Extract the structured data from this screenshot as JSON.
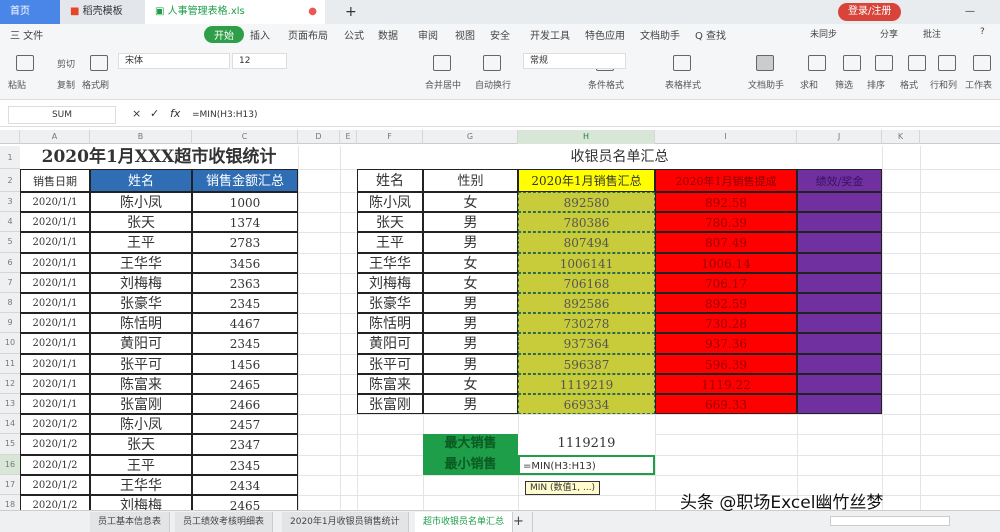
{
  "window": {
    "tabs": [
      {
        "label": "首页"
      },
      {
        "label": "稻壳模板"
      },
      {
        "label": "人事管理表格.xls"
      }
    ],
    "new_tab": "+",
    "user_button": "登录/注册"
  },
  "menu": {
    "file": "三 文件",
    "items": [
      "开始",
      "插入",
      "页面布局",
      "公式",
      "数据",
      "审阅",
      "视图",
      "安全",
      "开发工具",
      "特色应用",
      "文档助手",
      "Q 查找"
    ],
    "right": [
      "未同步",
      "分享",
      "批注",
      "?"
    ]
  },
  "ribbon": {
    "paste": "粘贴",
    "cut": "剪切",
    "copy": "复制",
    "format_painter": "格式刷",
    "font": "宋体",
    "size": "12",
    "merge": "合并居中",
    "wrap": "自动换行",
    "number_format": "常规",
    "cond_format": "条件格式",
    "table_style": "表格样式",
    "doc_helper": "文档助手",
    "sum": "求和",
    "filter": "筛选",
    "sort": "排序",
    "format": "格式",
    "rowcol": "行和列",
    "sheet": "工作表"
  },
  "formula_bar": {
    "name_box": "SUM",
    "cancel": "×",
    "confirm": "✓",
    "fx": "fx",
    "formula": "=MIN(H3:H13)"
  },
  "columns": [
    "A",
    "B",
    "C",
    "D",
    "E",
    "F",
    "G",
    "H",
    "I",
    "J",
    "K"
  ],
  "rows": [
    "1",
    "2",
    "3",
    "4",
    "5",
    "6",
    "7",
    "8",
    "9",
    "10",
    "11",
    "12",
    "13",
    "14",
    "15",
    "16",
    "17",
    "18"
  ],
  "left_table": {
    "title": "2020年1月XXX超市收银统计",
    "headers": [
      "销售日期",
      "姓名",
      "销售金额汇总"
    ],
    "rows": [
      [
        "2020/1/1",
        "陈小凤",
        "1000"
      ],
      [
        "2020/1/1",
        "张天",
        "1374"
      ],
      [
        "2020/1/1",
        "王平",
        "2783"
      ],
      [
        "2020/1/1",
        "王华华",
        "3456"
      ],
      [
        "2020/1/1",
        "刘梅梅",
        "2363"
      ],
      [
        "2020/1/1",
        "张豪华",
        "2345"
      ],
      [
        "2020/1/1",
        "陈恬明",
        "4467"
      ],
      [
        "2020/1/1",
        "黄阳可",
        "2345"
      ],
      [
        "2020/1/1",
        "张平可",
        "1456"
      ],
      [
        "2020/1/1",
        "陈富来",
        "2465"
      ],
      [
        "2020/1/1",
        "张富刚",
        "2466"
      ],
      [
        "2020/1/2",
        "陈小凤",
        "2457"
      ],
      [
        "2020/1/2",
        "张天",
        "2347"
      ],
      [
        "2020/1/2",
        "王平",
        "2345"
      ],
      [
        "2020/1/2",
        "王华华",
        "2434"
      ],
      [
        "2020/1/2",
        "刘梅梅",
        "2465"
      ]
    ]
  },
  "right_table": {
    "title": "收银员名单汇总",
    "headers": [
      "姓名",
      "性别",
      "2020年1月销售汇总",
      "2020年1月销售提成",
      "绩效/奖金"
    ],
    "rows": [
      [
        "陈小凤",
        "女",
        "892580",
        "892.58"
      ],
      [
        "张天",
        "男",
        "780386",
        "780.39"
      ],
      [
        "王平",
        "男",
        "807494",
        "807.49"
      ],
      [
        "王华华",
        "女",
        "1006141",
        "1006.14"
      ],
      [
        "刘梅梅",
        "女",
        "706168",
        "706.17"
      ],
      [
        "张豪华",
        "男",
        "892586",
        "892.59"
      ],
      [
        "陈恬明",
        "男",
        "730278",
        "730.28"
      ],
      [
        "黄阳可",
        "男",
        "937364",
        "937.36"
      ],
      [
        "张平可",
        "男",
        "596387",
        "596.39"
      ],
      [
        "陈富来",
        "女",
        "1119219",
        "1119.22"
      ],
      [
        "张富刚",
        "男",
        "669334",
        "669.33"
      ]
    ]
  },
  "summary": {
    "max_label": "最大销售",
    "max_value": "1119219",
    "min_label": "最小销售",
    "min_formula": "=MIN(H3:H13)",
    "tooltip": "MIN (数值1, ...)"
  },
  "sheet_tabs": [
    "员工基本信息表",
    "员工绩效考核明细表",
    "2020年1月收银员销售统计",
    "超市收银员名单汇总"
  ],
  "add_sheet": "+",
  "watermark": "头条 @职场Excel幽竹丝梦",
  "colors": {
    "yellow": "#ffff00",
    "olive": "#c8cc3a",
    "red": "#ff0000",
    "purple": "#7030a0",
    "green": "#1e9e48",
    "blue": "#2f6eb5"
  }
}
